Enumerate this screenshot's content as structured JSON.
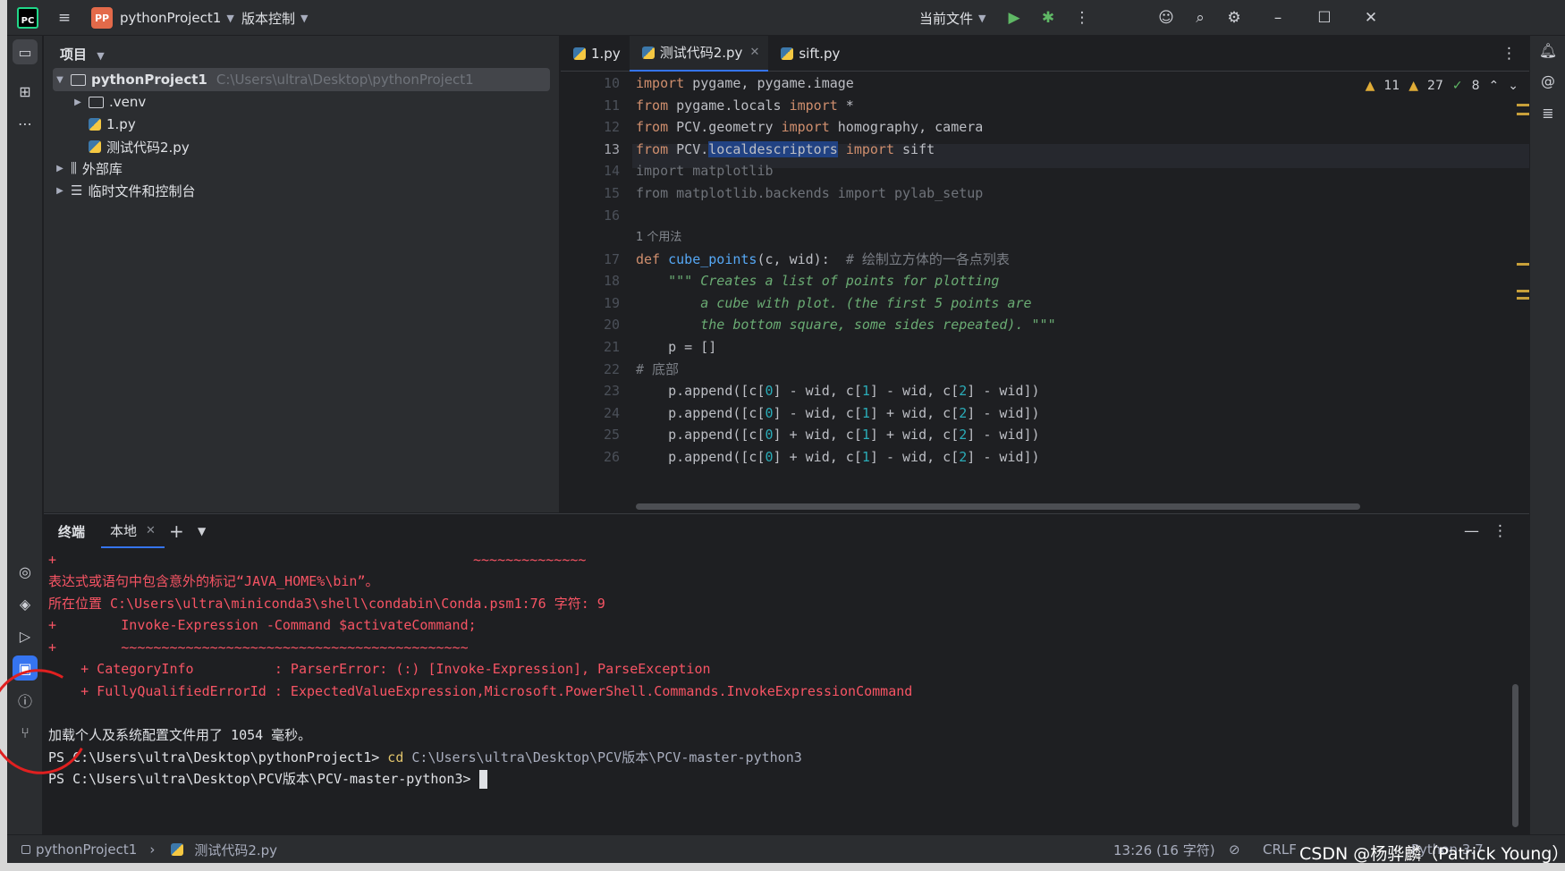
{
  "titlebar": {
    "logo": "PC",
    "project_badge": "PP",
    "project_name": "pythonProject1",
    "vcs": "版本控制",
    "run_config": "当前文件",
    "icons": [
      "run-icon",
      "debug-icon",
      "more-icon",
      "add-user-icon",
      "search-icon",
      "settings-icon",
      "minimize-icon",
      "maximize-icon",
      "close-icon"
    ]
  },
  "project_panel": {
    "header": "项目",
    "tree": [
      {
        "name": "pythonProject1",
        "path": "C:\\Users\\ultra\\Desktop\\pythonProject1",
        "type": "folder",
        "expanded": true
      },
      {
        "name": ".venv",
        "type": "folder",
        "expanded": false
      },
      {
        "name": "1.py",
        "type": "python"
      },
      {
        "name": "测试代码2.py",
        "type": "python"
      },
      {
        "name": "外部库",
        "type": "library"
      },
      {
        "name": "临时文件和控制台",
        "type": "scratch"
      }
    ]
  },
  "editor": {
    "tabs": [
      {
        "label": "1.py",
        "active": false
      },
      {
        "label": "测试代码2.py",
        "active": true
      },
      {
        "label": "sift.py",
        "active": false
      }
    ],
    "inspections": {
      "warnings": "11",
      "weak_warnings": "27",
      "ok": "8"
    },
    "line_numbers": [
      "10",
      "11",
      "12",
      "13",
      "14",
      "15",
      "16",
      "",
      "17",
      "18",
      "19",
      "20",
      "21",
      "22",
      "23",
      "24",
      "25",
      "26"
    ],
    "usage_hint": "1 个用法",
    "comment_cube": "# 绘制立方体的一各点列表",
    "comment_bottom": "# 底部"
  },
  "terminal": {
    "header": "终端",
    "tab": "本地",
    "lines": {
      "l1_plus": "+",
      "l1_tilde": "~~~~~~~~~~~~~~",
      "l2": "表达式或语句中包含意外的标记“JAVA_HOME%\\bin”。",
      "l3": "所在位置 C:\\Users\\ultra\\miniconda3\\shell\\condabin\\Conda.psm1:76 字符: 9",
      "l4_plus": "+",
      "l4": "        Invoke-Expression -Command $activateCommand;",
      "l5_plus": "+",
      "l5": "        ~~~~~~~~~~~~~~~~~~~~~~~~~~~~~~~~~~~~~~~~~~~",
      "l6": "    + CategoryInfo          : ParserError: (:) [Invoke-Expression], ParseException",
      "l7": "    + FullyQualifiedErrorId : ExpectedValueExpression,Microsoft.PowerShell.Commands.InvokeExpressionCommand",
      "l8": "加载个人及系统配置文件用了 1054 毫秒。",
      "l9_prompt": "PS C:\\Users\\ultra\\Desktop\\pythonProject1> ",
      "l9_cmd": "cd",
      "l9_arg": " C:\\Users\\ultra\\Desktop\\PCV版本\\PCV-master-python3",
      "l10_prompt": "PS C:\\Users\\ultra\\Desktop\\PCV版本\\PCV-master-python3> "
    }
  },
  "statusbar": {
    "project": "pythonProject1",
    "file": "测试代码2.py",
    "position": "13:26 (16 字符)",
    "line_sep": "CRLF",
    "interpreter": "Python 3.7"
  },
  "watermark": "CSDN @杨骅麟（Patrick Young）",
  "colors": {
    "accent": "#3574f0",
    "error": "#f75464",
    "keyword": "#cf8e6d",
    "function": "#56a8f5",
    "docstring": "#6aab73",
    "number": "#2aacb8",
    "annotation": "#e02020"
  }
}
